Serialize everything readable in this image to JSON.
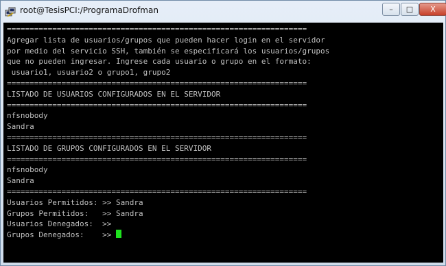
{
  "window": {
    "title": "root@TesisPCI:/ProgramaDrofman",
    "controls": {
      "minimize": "–",
      "maximize": "□",
      "close": "X"
    }
  },
  "terminal": {
    "lines": [
      "==================================================================",
      "Agregar lista de usuarios/grupos que pueden hacer login en el servidor",
      "por medio del servicio SSH, también se especificará los usuarios/grupos",
      "que no pueden ingresar. Ingrese cada usuario o grupo en el formato:",
      " usuario1, usuario2 o grupo1, grupo2",
      "==================================================================",
      "LISTADO DE USUARIOS CONFIGURADOS EN EL SERVIDOR",
      "==================================================================",
      "nfsnobody",
      "Sandra",
      "==================================================================",
      "LISTADO DE GRUPOS CONFIGURADOS EN EL SERVIDOR",
      "==================================================================",
      "nfsnobody",
      "Sandra",
      "==================================================================",
      "Usuarios Permitidos: >> Sandra",
      "Grupos Permitidos:   >> Sandra",
      "Usuarios Denegados:  >>",
      "Grupos Denegados:    >> "
    ],
    "cursor_color": "#1ee11e"
  }
}
